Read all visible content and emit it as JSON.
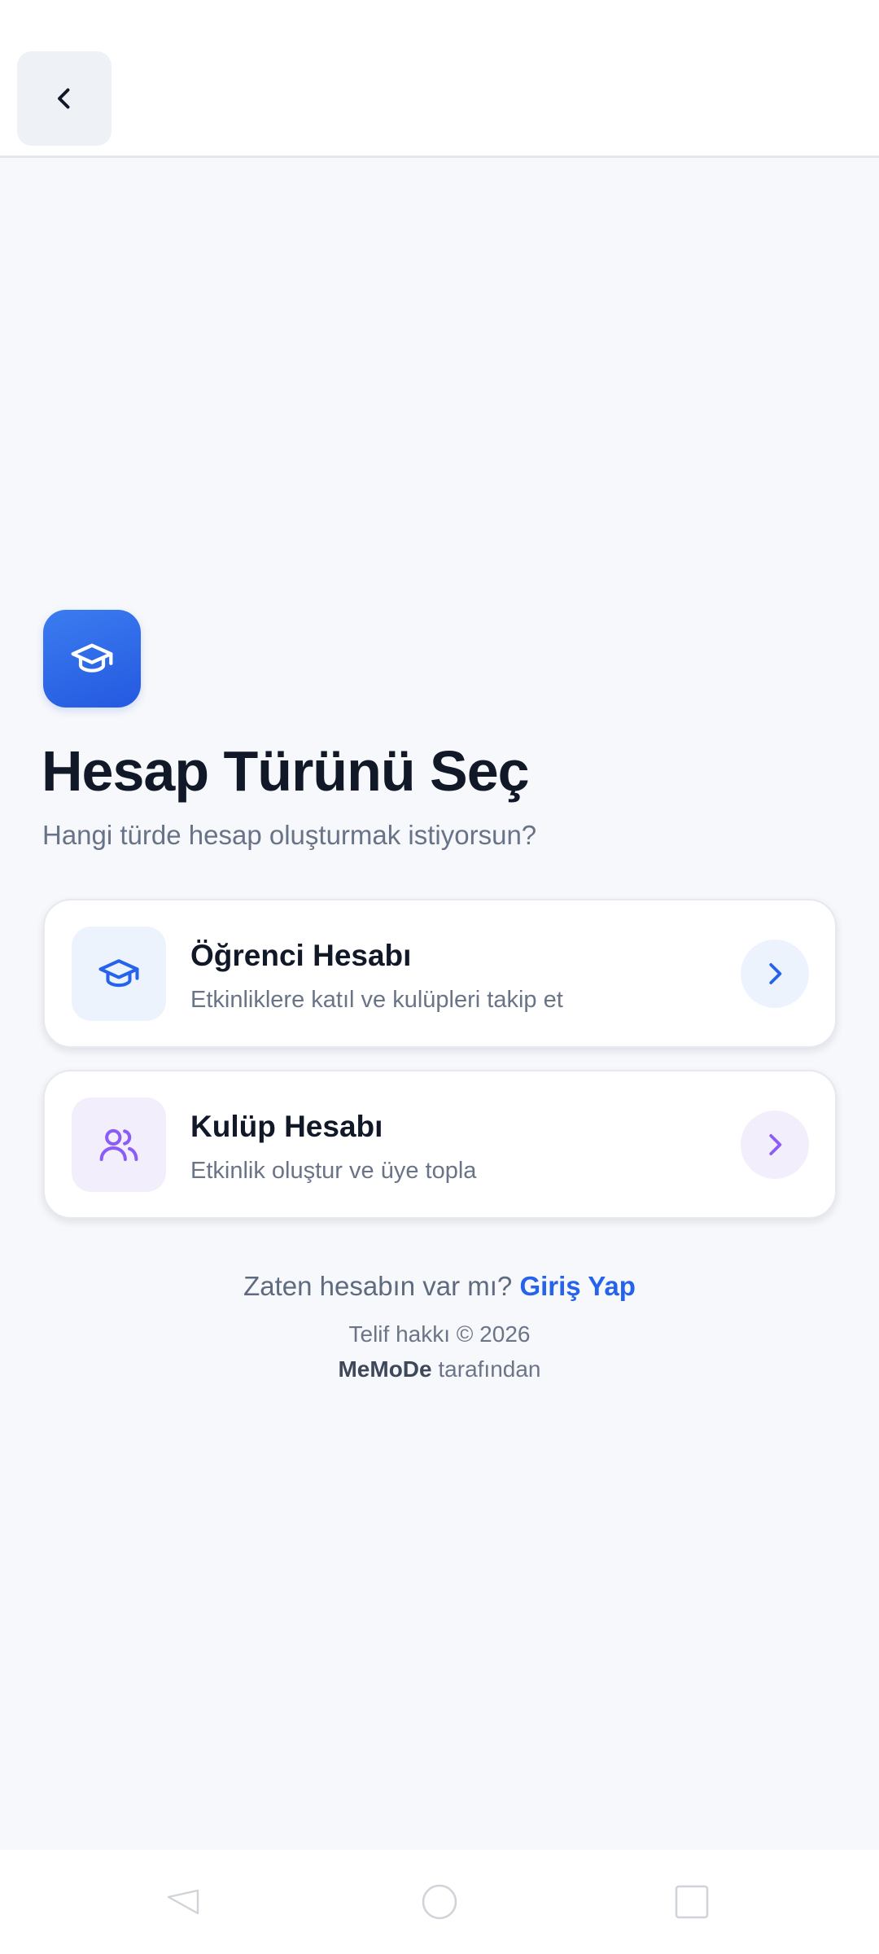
{
  "header": {
    "back_icon": "chevron-left-icon"
  },
  "hero": {
    "logo_icon": "graduation-cap-icon",
    "title": "Hesap Türünü Seç",
    "subtitle": "Hangi türde hesap oluşturmak istiyorsun?"
  },
  "options": [
    {
      "icon": "graduation-cap-icon",
      "title": "Öğrenci Hesabı",
      "description": "Etkinliklere katıl ve kulüpleri takip et",
      "accent_color": "#2563eb"
    },
    {
      "icon": "users-icon",
      "title": "Kulüp Hesabı",
      "description": "Etkinlik oluştur ve üye topla",
      "accent_color": "#8b5cf6"
    }
  ],
  "footer": {
    "login_prompt": "Zaten hesabın var mı?",
    "login_link": "Giriş Yap",
    "copyright": "Telif hakkı © 2026",
    "brand": "MeMoDe",
    "byline_suffix": "tarafından"
  },
  "colors": {
    "primary": "#2563eb",
    "title_text": "#111827",
    "muted_text": "#687387",
    "background": "#f7f8fb"
  },
  "navbar": {
    "icons": [
      "nav-back-icon",
      "nav-home-icon",
      "nav-recents-icon"
    ]
  }
}
